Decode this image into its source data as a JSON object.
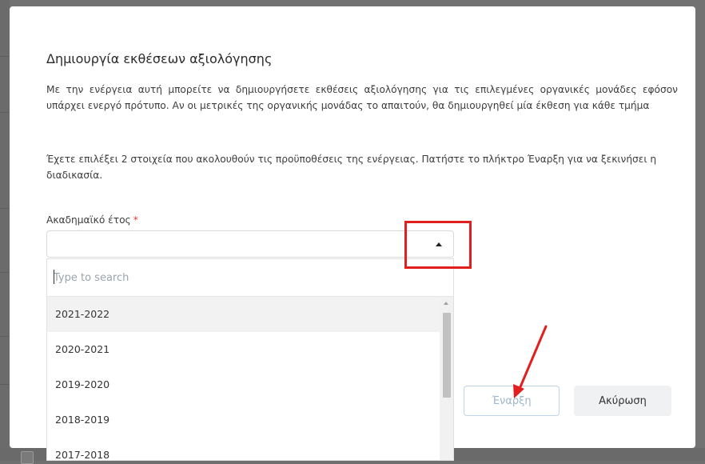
{
  "dialog": {
    "title": "Δημιουργία εκθέσεων αξιολόγησης",
    "description": "Με την ενέργεια αυτή μπορείτε να δημιουργήσετε εκθέσεις αξιολόγησης για τις επιλεγμένες οργανικές μονάδες εφόσον υπάρχει ενεργό πρότυπο. Αν οι μετρικές της οργανικής μονάδας το απαιτούν, θα δημιουργηθεί μία έκθεση για κάθε τμήμα",
    "info": "Έχετε επιλέξει 2 στοιχεία που ακολουθούν τις προϋποθέσεις της ενέργειας. Πατήστε το πλήκτρο Έναρξη για να ξεκινήσει η διαδικασία.",
    "academic_year": {
      "label": "Ακαδημαϊκό έτος",
      "required_mark": "*",
      "value": "",
      "search_placeholder": "Type to search",
      "options": [
        "2021-2022",
        "2020-2021",
        "2019-2020",
        "2018-2019",
        "2017-2018"
      ]
    },
    "buttons": {
      "start": "Έναρξη",
      "cancel": "Ακύρωση"
    }
  },
  "annotations": {
    "highlight_color": "#e21f1f"
  },
  "colors": {
    "overlay": "#727272",
    "selected_option_bg": "#f2f2f2",
    "start_button_text": "#9fb6c9",
    "cancel_button_bg": "#eff1f3"
  },
  "icons": [
    "caret-up-icon",
    "scroll-up-icon"
  ]
}
